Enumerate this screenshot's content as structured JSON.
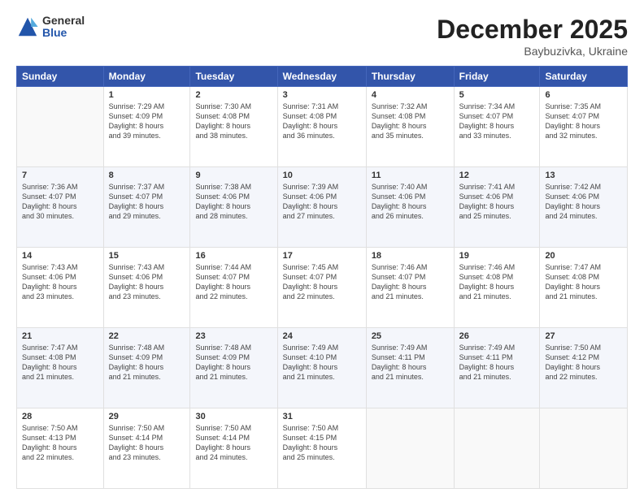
{
  "logo": {
    "general": "General",
    "blue": "Blue"
  },
  "header": {
    "month": "December 2025",
    "location": "Baybuzivka, Ukraine"
  },
  "weekdays": [
    "Sunday",
    "Monday",
    "Tuesday",
    "Wednesday",
    "Thursday",
    "Friday",
    "Saturday"
  ],
  "weeks": [
    [
      {
        "day": "",
        "info": ""
      },
      {
        "day": "1",
        "info": "Sunrise: 7:29 AM\nSunset: 4:09 PM\nDaylight: 8 hours\nand 39 minutes."
      },
      {
        "day": "2",
        "info": "Sunrise: 7:30 AM\nSunset: 4:08 PM\nDaylight: 8 hours\nand 38 minutes."
      },
      {
        "day": "3",
        "info": "Sunrise: 7:31 AM\nSunset: 4:08 PM\nDaylight: 8 hours\nand 36 minutes."
      },
      {
        "day": "4",
        "info": "Sunrise: 7:32 AM\nSunset: 4:08 PM\nDaylight: 8 hours\nand 35 minutes."
      },
      {
        "day": "5",
        "info": "Sunrise: 7:34 AM\nSunset: 4:07 PM\nDaylight: 8 hours\nand 33 minutes."
      },
      {
        "day": "6",
        "info": "Sunrise: 7:35 AM\nSunset: 4:07 PM\nDaylight: 8 hours\nand 32 minutes."
      }
    ],
    [
      {
        "day": "7",
        "info": "Sunrise: 7:36 AM\nSunset: 4:07 PM\nDaylight: 8 hours\nand 30 minutes."
      },
      {
        "day": "8",
        "info": "Sunrise: 7:37 AM\nSunset: 4:07 PM\nDaylight: 8 hours\nand 29 minutes."
      },
      {
        "day": "9",
        "info": "Sunrise: 7:38 AM\nSunset: 4:06 PM\nDaylight: 8 hours\nand 28 minutes."
      },
      {
        "day": "10",
        "info": "Sunrise: 7:39 AM\nSunset: 4:06 PM\nDaylight: 8 hours\nand 27 minutes."
      },
      {
        "day": "11",
        "info": "Sunrise: 7:40 AM\nSunset: 4:06 PM\nDaylight: 8 hours\nand 26 minutes."
      },
      {
        "day": "12",
        "info": "Sunrise: 7:41 AM\nSunset: 4:06 PM\nDaylight: 8 hours\nand 25 minutes."
      },
      {
        "day": "13",
        "info": "Sunrise: 7:42 AM\nSunset: 4:06 PM\nDaylight: 8 hours\nand 24 minutes."
      }
    ],
    [
      {
        "day": "14",
        "info": "Sunrise: 7:43 AM\nSunset: 4:06 PM\nDaylight: 8 hours\nand 23 minutes."
      },
      {
        "day": "15",
        "info": "Sunrise: 7:43 AM\nSunset: 4:06 PM\nDaylight: 8 hours\nand 23 minutes."
      },
      {
        "day": "16",
        "info": "Sunrise: 7:44 AM\nSunset: 4:07 PM\nDaylight: 8 hours\nand 22 minutes."
      },
      {
        "day": "17",
        "info": "Sunrise: 7:45 AM\nSunset: 4:07 PM\nDaylight: 8 hours\nand 22 minutes."
      },
      {
        "day": "18",
        "info": "Sunrise: 7:46 AM\nSunset: 4:07 PM\nDaylight: 8 hours\nand 21 minutes."
      },
      {
        "day": "19",
        "info": "Sunrise: 7:46 AM\nSunset: 4:08 PM\nDaylight: 8 hours\nand 21 minutes."
      },
      {
        "day": "20",
        "info": "Sunrise: 7:47 AM\nSunset: 4:08 PM\nDaylight: 8 hours\nand 21 minutes."
      }
    ],
    [
      {
        "day": "21",
        "info": "Sunrise: 7:47 AM\nSunset: 4:08 PM\nDaylight: 8 hours\nand 21 minutes."
      },
      {
        "day": "22",
        "info": "Sunrise: 7:48 AM\nSunset: 4:09 PM\nDaylight: 8 hours\nand 21 minutes."
      },
      {
        "day": "23",
        "info": "Sunrise: 7:48 AM\nSunset: 4:09 PM\nDaylight: 8 hours\nand 21 minutes."
      },
      {
        "day": "24",
        "info": "Sunrise: 7:49 AM\nSunset: 4:10 PM\nDaylight: 8 hours\nand 21 minutes."
      },
      {
        "day": "25",
        "info": "Sunrise: 7:49 AM\nSunset: 4:11 PM\nDaylight: 8 hours\nand 21 minutes."
      },
      {
        "day": "26",
        "info": "Sunrise: 7:49 AM\nSunset: 4:11 PM\nDaylight: 8 hours\nand 21 minutes."
      },
      {
        "day": "27",
        "info": "Sunrise: 7:50 AM\nSunset: 4:12 PM\nDaylight: 8 hours\nand 22 minutes."
      }
    ],
    [
      {
        "day": "28",
        "info": "Sunrise: 7:50 AM\nSunset: 4:13 PM\nDaylight: 8 hours\nand 22 minutes."
      },
      {
        "day": "29",
        "info": "Sunrise: 7:50 AM\nSunset: 4:14 PM\nDaylight: 8 hours\nand 23 minutes."
      },
      {
        "day": "30",
        "info": "Sunrise: 7:50 AM\nSunset: 4:14 PM\nDaylight: 8 hours\nand 24 minutes."
      },
      {
        "day": "31",
        "info": "Sunrise: 7:50 AM\nSunset: 4:15 PM\nDaylight: 8 hours\nand 25 minutes."
      },
      {
        "day": "",
        "info": ""
      },
      {
        "day": "",
        "info": ""
      },
      {
        "day": "",
        "info": ""
      }
    ]
  ]
}
